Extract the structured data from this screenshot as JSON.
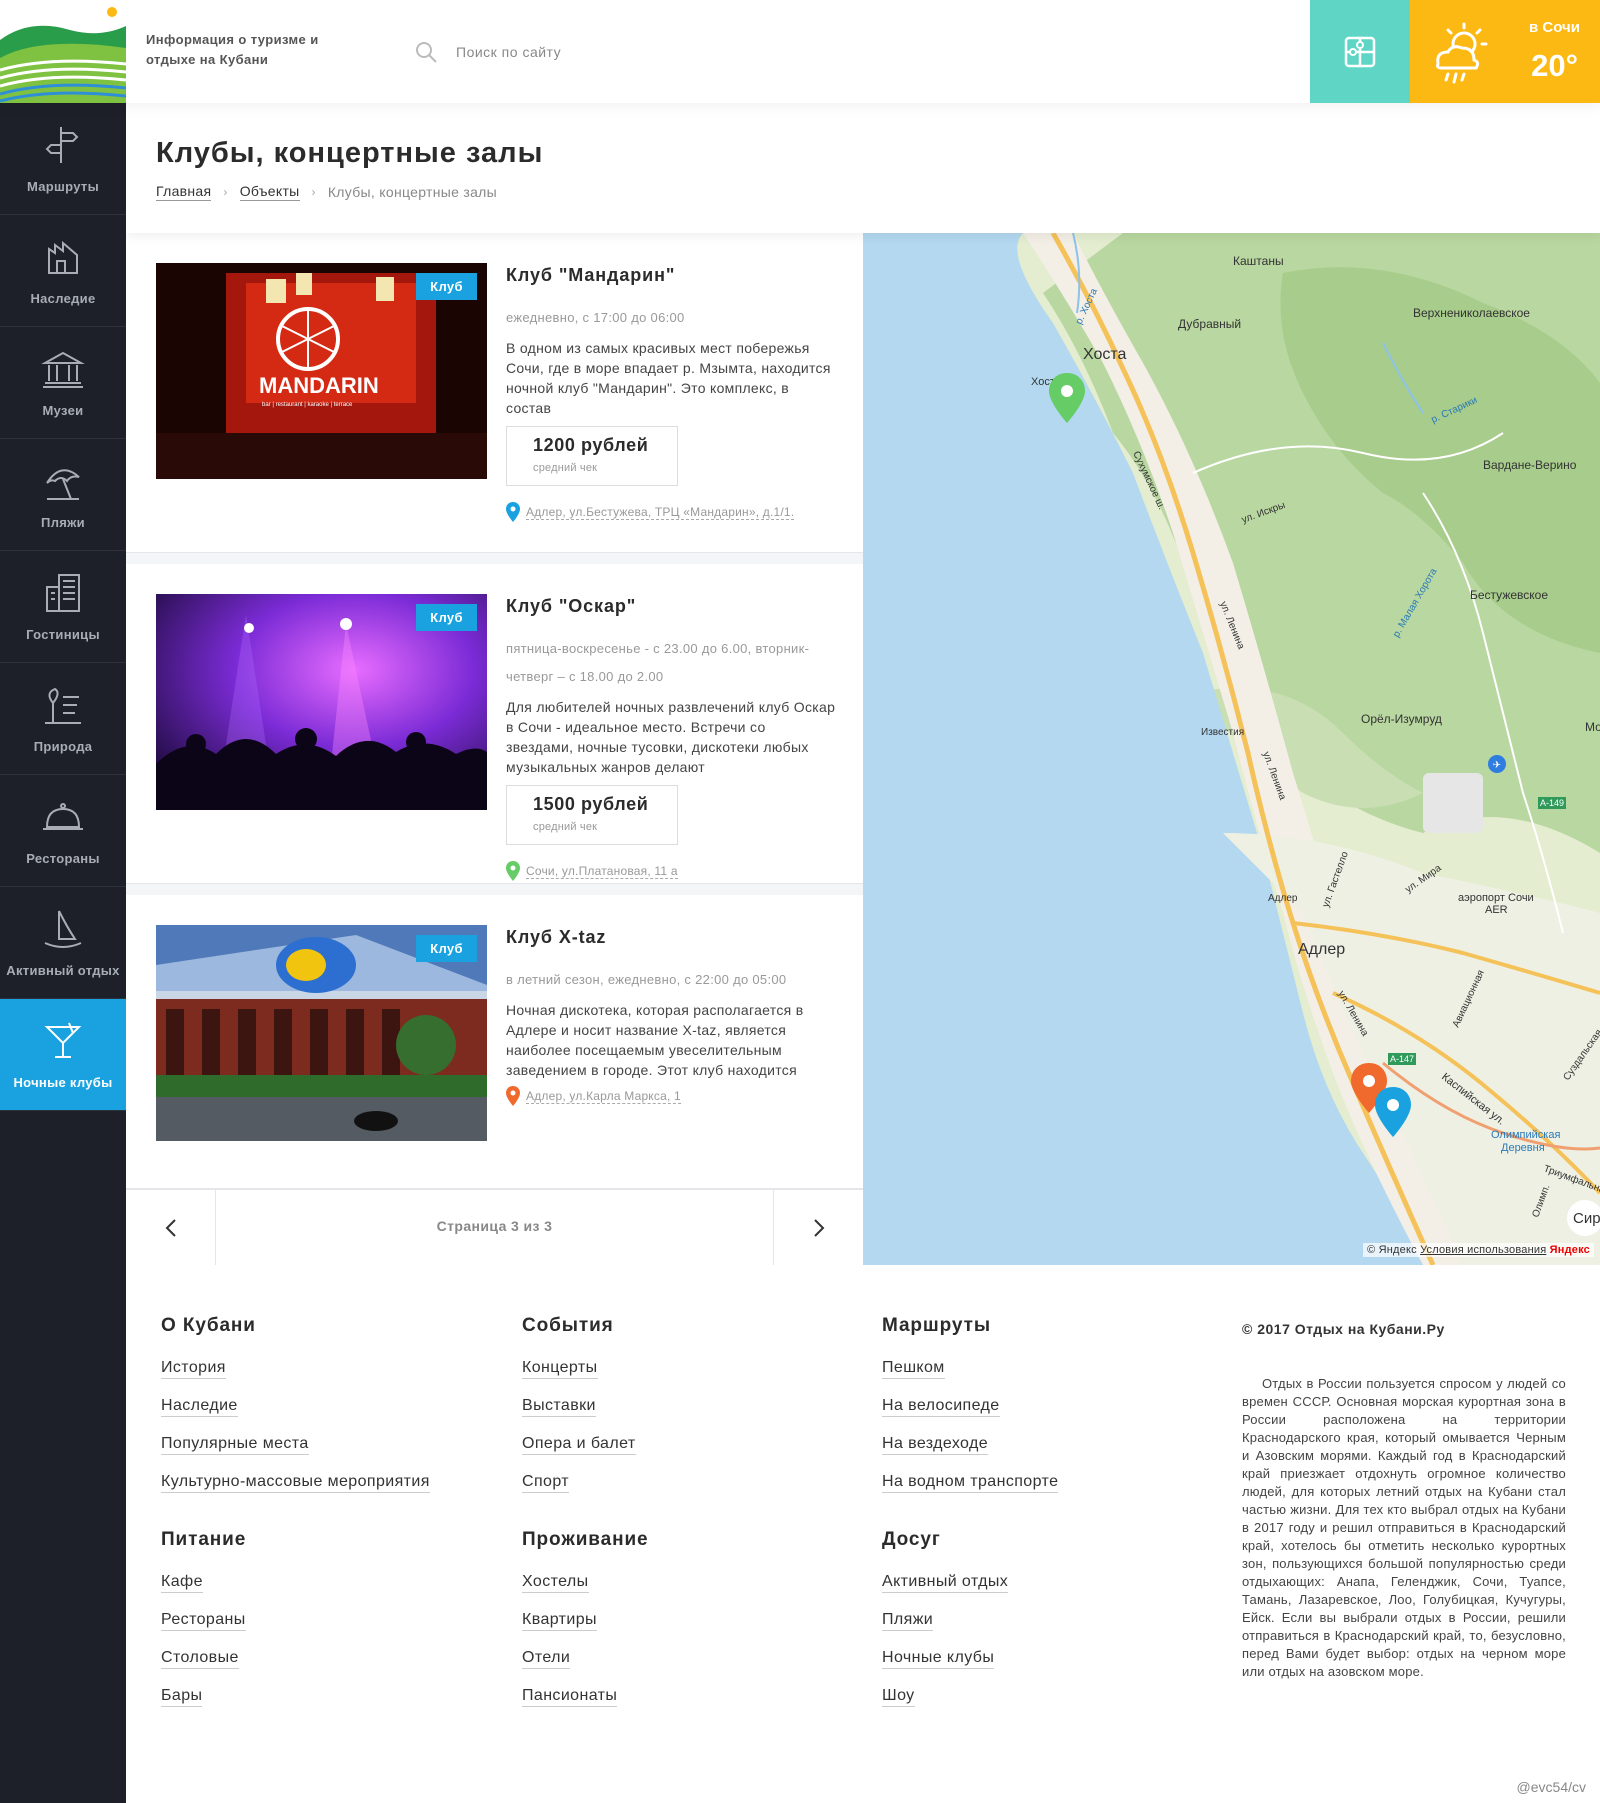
{
  "header": {
    "tagline": "Информация о туризме и отдыхе на Кубани",
    "search_placeholder": "Поиск по сайту",
    "weather": {
      "city": "в Сочи",
      "temp": "20°"
    }
  },
  "sidebar": {
    "items": [
      {
        "label": "Маршруты",
        "icon": "signpost-icon"
      },
      {
        "label": "Наследие",
        "icon": "heritage-icon"
      },
      {
        "label": "Музеи",
        "icon": "museum-icon"
      },
      {
        "label": "Пляжи",
        "icon": "beach-icon"
      },
      {
        "label": "Гостиницы",
        "icon": "hotel-icon"
      },
      {
        "label": "Природа",
        "icon": "nature-icon"
      },
      {
        "label": "Рестораны",
        "icon": "restaurant-icon"
      },
      {
        "label": "Активный отдых",
        "icon": "sailboat-icon"
      },
      {
        "label": "Ночные клубы",
        "icon": "cocktail-icon",
        "active": true
      }
    ]
  },
  "page": {
    "title": "Клубы, концертные залы",
    "breadcrumb": [
      "Главная",
      "Объекты",
      "Клубы, концертные залы"
    ]
  },
  "cards": [
    {
      "tag": "Клуб",
      "title": "Клуб \"Мандарин\"",
      "hours": "ежедневно, с 17:00 до 06:00",
      "description": "В одном из самых красивых мест побережья Сочи, где в море впадает р. Мзымта, находится ночной клуб \"Мандарин\". Это комплекс, в состав",
      "price": "1200 рублей",
      "price_label": "средний чек",
      "address": "Адлер, ул.Бестужева, ТРЦ «Мандарин», д.1/1.",
      "pin_color": "#19a2df",
      "image_text": "MANDARIN",
      "image_subtext": "bar | restaurant | karaoke | terrace"
    },
    {
      "tag": "Клуб",
      "title": "Клуб \"Оскар\"",
      "hours": "пятница-воскресенье - с 23.00 до 6.00, вторник-четверг – с 18.00 до 2.00",
      "description": "Для любителей ночных развлечений клуб Оскар в Сочи - идеальное место. Встречи со звездами, ночные тусовки, дискотеки любых музыкальных жанров делают",
      "price": "1500 рублей",
      "price_label": "средний чек",
      "address": "Сочи, ул.Платановая, 11 а",
      "pin_color": "#66cc66"
    },
    {
      "tag": "Клуб",
      "title": "Клуб X-taz",
      "hours": "в летний сезон, ежедневно, с 22:00 до 05:00",
      "description": "Ночная дискотека, которая располагается в Адлере и носит название X-taz, является наиболее посещаемым увеселительным заведением в городе. Этот клуб находится",
      "address": "Адлер, ул.Карла Маркса, 1",
      "pin_color": "#f06a2e"
    }
  ],
  "pagination": {
    "text": "Страница 3 из 3"
  },
  "map": {
    "labels": [
      "Каштаны",
      "Дубравный",
      "Верхнениколаевское",
      "Хоста",
      "Хоста",
      "р. Хоста",
      "р. Старики",
      "Вардане-Верино",
      "Сухумское ш.",
      "ул. Искры",
      "р. Малая Хорота",
      "Бестужевское",
      "ул. Ленина",
      "Орёл-Изумруд",
      "Известия",
      "ул. Ленина",
      "Мо",
      "А-149",
      "ул. Гастелло",
      "ул. Мира",
      "аэропорт Сочи",
      "AER",
      "Адлер",
      "Адлер",
      "ул. Ленина",
      "Авиационная",
      "А-147",
      "Каспийская ул.",
      "Суздальская",
      "Олимпийская",
      "Деревня",
      "Триумфальная",
      "Олимп.",
      "Сир"
    ],
    "credit": "© Яндекс",
    "terms": "Условия использования",
    "brand": "Яндекс"
  },
  "footer": {
    "columns": [
      {
        "title": "О Кубани",
        "links": [
          "История",
          "Наследие",
          "Популярные места",
          "Культурно-массовые мероприятия"
        ]
      },
      {
        "title": "События",
        "links": [
          "Концерты",
          "Выставки",
          "Опера и балет",
          "Спорт"
        ]
      },
      {
        "title": "Маршруты",
        "links": [
          "Пешком",
          "На велосипеде",
          "На вездеходе",
          "На водном транспорте"
        ]
      },
      {
        "title": "Питание",
        "links": [
          "Кафе",
          "Рестораны",
          "Столовые",
          "Бары"
        ]
      },
      {
        "title": "Проживание",
        "links": [
          "Хостелы",
          "Квартиры",
          "Отели",
          "Пансионаты"
        ]
      },
      {
        "title": "Досуг",
        "links": [
          "Активный отдых",
          "Пляжи",
          "Ночные клубы",
          "Шоу"
        ]
      }
    ],
    "copyright": "© 2017 Отдых на Кубани.Ру",
    "about": "Отдых в России пользуется спросом у людей со времен СССР. Основная морская курортная зона в России расположена на территории Краснодарского края, который омывается Черным и Азовским морями. Каждый год в Краснодарский край приезжает отдохнуть огромное количество людей, для которых летний отдых на Кубани стал частью жизни. Для тех кто выбрал отдых на Кубани в 2017 году и решил отправиться в Краснодарский край, хотелось бы отметить несколько курортных зон, пользующихся большой популярностью среди отдыхающих: Анапа, Геленджик, Сочи, Туапсе, Тамань, Лазаревское, Лоо, Голубицкая, Кучугуры, Ейск. Если вы выбрали отдых в России, решили отправиться в Краснодарский край, то, безусловно, перед Вами будет выбор: отдых на черном море или отдых на азовском море.",
    "signature": "@evc54/cv"
  },
  "colors": {
    "accent_blue": "#19a2df",
    "sidebar_bg": "#1d2029",
    "teal": "#5fd6c5",
    "weather_yellow": "#fdb913"
  }
}
